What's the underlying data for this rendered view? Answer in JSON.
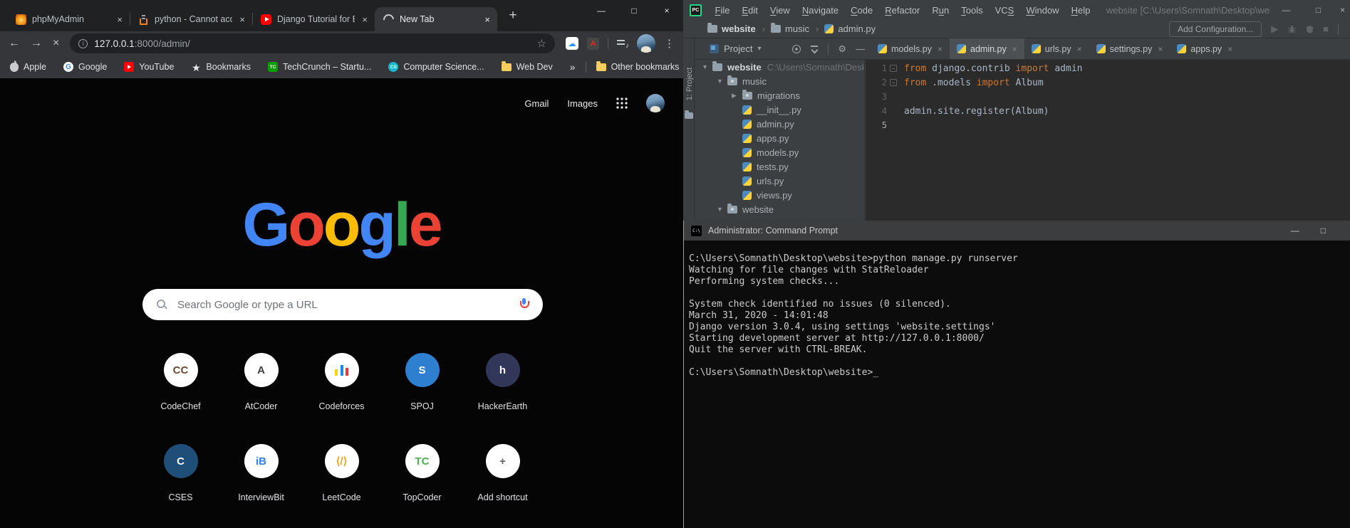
{
  "chrome": {
    "glyphs": {
      "close": "×",
      "minimize": "—",
      "maximize": "□",
      "new_tab": "+",
      "back": "←",
      "forward": "→",
      "stop": "×",
      "star": "☆",
      "kebab": "⋮",
      "overflow": "»"
    },
    "tabs": [
      {
        "title": "phpMyAdmin",
        "icon": "phpmyadmin",
        "state": ""
      },
      {
        "title": "python - Cannot acces",
        "icon": "stackoverflow",
        "state": ""
      },
      {
        "title": "Django Tutorial for Be",
        "icon": "youtube",
        "state": ""
      },
      {
        "title": "New Tab",
        "icon": "spinner",
        "state": "active"
      }
    ],
    "address": {
      "host": "127.0.0.1",
      "path": ":8000/admin/"
    },
    "bookmarks": [
      {
        "label": "Apple",
        "icon": "apple"
      },
      {
        "label": "Google",
        "icon": "google"
      },
      {
        "label": "YouTube",
        "icon": "youtube"
      },
      {
        "label": "Bookmarks",
        "icon": "star"
      },
      {
        "label": "TechCrunch – Startu...",
        "icon": "techcrunch"
      },
      {
        "label": "Computer Science...",
        "icon": "compsci"
      },
      {
        "label": "Web Dev",
        "icon": "folder"
      }
    ],
    "other_bookmarks": "Other bookmarks",
    "ntp": {
      "gmail": "Gmail",
      "images": "Images",
      "logo": [
        {
          "ch": "G",
          "color": "#4285F4"
        },
        {
          "ch": "o",
          "color": "#EA4335"
        },
        {
          "ch": "o",
          "color": "#FBBC05"
        },
        {
          "ch": "g",
          "color": "#4285F4"
        },
        {
          "ch": "l",
          "color": "#34A853"
        },
        {
          "ch": "e",
          "color": "#EA4335"
        }
      ],
      "search_placeholder": "Search Google or type a URL",
      "shortcuts": [
        {
          "label": "CodeChef",
          "glyph": "CC",
          "fg": "#6e4a2f",
          "bg": "",
          "gtype": "g-text"
        },
        {
          "label": "AtCoder",
          "glyph": "A",
          "fg": "#3f3f3f",
          "bg": "",
          "gtype": "g-text"
        },
        {
          "label": "Codeforces",
          "glyph": "",
          "fg": "",
          "bg": "",
          "gtype": "g-bars"
        },
        {
          "label": "SPOJ",
          "glyph": "S",
          "fg": "#ffffff",
          "bg": "#2f7fd0",
          "gtype": "g-text"
        },
        {
          "label": "HackerEarth",
          "glyph": "h",
          "fg": "#ffffff",
          "bg": "#32375a",
          "gtype": "g-text"
        },
        {
          "label": "CSES",
          "glyph": "C",
          "fg": "#ffffff",
          "bg": "#1f4e79",
          "gtype": "g-text"
        },
        {
          "label": "InterviewBit",
          "glyph": "iB",
          "fg": "#2d7ff0",
          "bg": "",
          "gtype": "g-text"
        },
        {
          "label": "LeetCode",
          "glyph": "⟨/⟩",
          "fg": "#f8a01c",
          "bg": "",
          "gtype": "g-text"
        },
        {
          "label": "TopCoder",
          "glyph": "TC",
          "fg": "#4caf50",
          "bg": "",
          "gtype": "g-text"
        },
        {
          "label": "Add shortcut",
          "glyph": "+",
          "fg": "#5f6368",
          "bg": "",
          "gtype": "g-text"
        }
      ]
    }
  },
  "pycharm": {
    "logo": "PC",
    "menu": [
      {
        "pre": "",
        "u": "F",
        "rest": "ile"
      },
      {
        "pre": "",
        "u": "E",
        "rest": "dit"
      },
      {
        "pre": "",
        "u": "V",
        "rest": "iew"
      },
      {
        "pre": "",
        "u": "N",
        "rest": "avigate"
      },
      {
        "pre": "",
        "u": "C",
        "rest": "ode"
      },
      {
        "pre": "",
        "u": "R",
        "rest": "efactor"
      },
      {
        "pre": "R",
        "u": "u",
        "rest": "n"
      },
      {
        "pre": "",
        "u": "T",
        "rest": "ools"
      },
      {
        "pre": "VC",
        "u": "S",
        "rest": ""
      },
      {
        "pre": "",
        "u": "W",
        "rest": "indow"
      },
      {
        "pre": "",
        "u": "H",
        "rest": "elp"
      }
    ],
    "window_title": "website [C:\\Users\\Somnath\\Desktop\\website] - ...\\admin.py",
    "glyphs": {
      "minimize": "—",
      "maximize": "□",
      "close": "×",
      "caret": "▾",
      "panel_minimize": "—",
      "tab_close": "×",
      "run": "▶",
      "stop": "■"
    },
    "breadcrumbs": [
      {
        "sep": "",
        "label": "website",
        "icon": "folder",
        "cls": "bold"
      },
      {
        "sep": "›",
        "label": "music",
        "icon": "folder",
        "cls": ""
      },
      {
        "sep": "›",
        "label": "admin.py",
        "icon": "python",
        "cls": ""
      }
    ],
    "add_configuration": "Add Configuration...",
    "project_panel": {
      "tool_label": "1: Project",
      "title": "Project"
    },
    "editor_tabs": [
      {
        "label": "models.py",
        "state": ""
      },
      {
        "label": "admin.py",
        "state": "active"
      },
      {
        "label": "urls.py",
        "state": ""
      },
      {
        "label": "settings.py",
        "state": ""
      },
      {
        "label": "apps.py",
        "state": ""
      }
    ],
    "tree": [
      {
        "label": "website",
        "path": "C:\\Users\\Somnath\\Desktop",
        "indent": 0,
        "arrow": "▼",
        "icon": "folder",
        "cls": "bold"
      },
      {
        "label": "music",
        "path": "",
        "indent": 1,
        "arrow": "▼",
        "icon": "package",
        "cls": ""
      },
      {
        "label": "migrations",
        "path": "",
        "indent": 2,
        "arrow": "▶",
        "icon": "package",
        "cls": ""
      },
      {
        "label": "__init__.py",
        "path": "",
        "indent": 2,
        "arrow": "",
        "icon": "python",
        "cls": ""
      },
      {
        "label": "admin.py",
        "path": "",
        "indent": 2,
        "arrow": "",
        "icon": "python",
        "cls": ""
      },
      {
        "label": "apps.py",
        "path": "",
        "indent": 2,
        "arrow": "",
        "icon": "python",
        "cls": ""
      },
      {
        "label": "models.py",
        "path": "",
        "indent": 2,
        "arrow": "",
        "icon": "python",
        "cls": ""
      },
      {
        "label": "tests.py",
        "path": "",
        "indent": 2,
        "arrow": "",
        "icon": "python",
        "cls": ""
      },
      {
        "label": "urls.py",
        "path": "",
        "indent": 2,
        "arrow": "",
        "icon": "python",
        "cls": ""
      },
      {
        "label": "views.py",
        "path": "",
        "indent": 2,
        "arrow": "",
        "icon": "python",
        "cls": ""
      },
      {
        "label": "website",
        "path": "",
        "indent": 1,
        "arrow": "▼",
        "icon": "package",
        "cls": ""
      }
    ],
    "code": [
      {
        "no": "1",
        "kw1": "from",
        "mid": " django.contrib ",
        "kw2": "import",
        "end": " admin",
        "fold": "has-fold",
        "cls": ""
      },
      {
        "no": "2",
        "kw1": "from",
        "mid": " .models ",
        "kw2": "import",
        "end": " Album",
        "fold": "has-fold",
        "cls": ""
      },
      {
        "no": "3",
        "kw1": "",
        "mid": "",
        "kw2": "",
        "end": "",
        "fold": "",
        "cls": ""
      },
      {
        "no": "4",
        "kw1": "",
        "mid": "admin.site.register(Album)",
        "kw2": "",
        "end": "",
        "fold": "",
        "cls": ""
      },
      {
        "no": "5",
        "kw1": "",
        "mid": "",
        "kw2": "",
        "end": "",
        "fold": "",
        "cls": "current"
      }
    ]
  },
  "terminal": {
    "title": "Administrator: Command Prompt",
    "glyphs": {
      "minimize": "—",
      "maximize": "□"
    },
    "lines": [
      "C:\\Users\\Somnath\\Desktop\\website>python manage.py runserver",
      "Watching for file changes with StatReloader",
      "Performing system checks...",
      "",
      "System check identified no issues (0 silenced).",
      "March 31, 2020 - 14:01:48",
      "Django version 3.0.4, using settings 'website.settings'",
      "Starting development server at http://127.0.0.1:8000/",
      "Quit the server with CTRL-BREAK.",
      "",
      "C:\\Users\\Somnath\\Desktop\\website>_"
    ]
  }
}
